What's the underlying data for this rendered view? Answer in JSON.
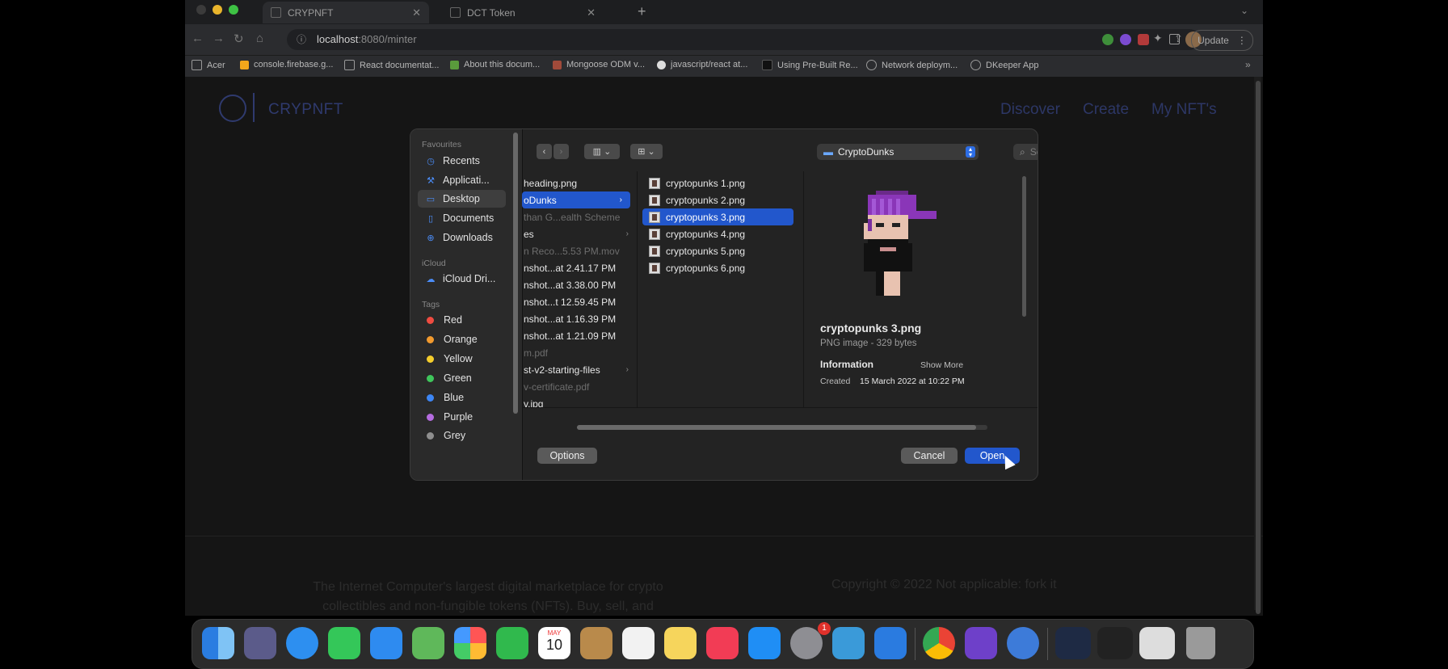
{
  "browser": {
    "tabs": [
      {
        "title": "CRYPNFT"
      },
      {
        "title": "DCT Token"
      }
    ],
    "url_host": "localhost",
    "url_path": ":8080/minter",
    "update_label": "Update",
    "bookmarks": [
      "Acer",
      "console.firebase.g...",
      "React documentat...",
      "About this docum...",
      "Mongoose ODM v...",
      "javascript/react at...",
      "Using Pre-Built Re...",
      "Network deploym...",
      "DKeeper App"
    ]
  },
  "page": {
    "logo": "CRYPNFT",
    "nav": [
      "Discover",
      "Create",
      "My NFT's"
    ],
    "footer_text": "The Internet Computer's largest digital marketplace for crypto collectibles and non-fungible tokens (NFTs). Buy, sell, and",
    "copyright": "Copyright © 2022 Not applicable: fork it"
  },
  "dialog": {
    "sidebar": {
      "favourites_heading": "Favourites",
      "favourites": [
        {
          "label": "Recents",
          "icon": "clock-icon"
        },
        {
          "label": "Applicati...",
          "icon": "applications-icon"
        },
        {
          "label": "Desktop",
          "icon": "desktop-icon",
          "selected": true
        },
        {
          "label": "Documents",
          "icon": "document-icon"
        },
        {
          "label": "Downloads",
          "icon": "downloads-icon"
        }
      ],
      "icloud_heading": "iCloud",
      "icloud": [
        {
          "label": "iCloud Dri...",
          "icon": "cloud-icon"
        }
      ],
      "tags_heading": "Tags",
      "tags": [
        {
          "label": "Red",
          "color": "#ef4c41"
        },
        {
          "label": "Orange",
          "color": "#f29a2e"
        },
        {
          "label": "Yellow",
          "color": "#f5cd2c"
        },
        {
          "label": "Green",
          "color": "#3fc65b"
        },
        {
          "label": "Blue",
          "color": "#3d86f5"
        },
        {
          "label": "Purple",
          "color": "#b56ce0"
        },
        {
          "label": "Grey",
          "color": "#8e8e8e"
        }
      ]
    },
    "location": "CryptoDunks",
    "search_placeholder": "Search",
    "column1": [
      {
        "label": "heading.png",
        "dim": false
      },
      {
        "label": "oDunks",
        "dim": false,
        "selected": true,
        "folder": true
      },
      {
        "label": "than G...ealth Scheme",
        "dim": true
      },
      {
        "label": "es",
        "dim": false,
        "folder": true
      },
      {
        "label": "n Reco...5.53 PM.mov",
        "dim": true
      },
      {
        "label": "nshot...at 2.41.17 PM",
        "dim": false
      },
      {
        "label": "nshot...at 3.38.00 PM",
        "dim": false
      },
      {
        "label": "nshot...t 12.59.45 PM",
        "dim": false
      },
      {
        "label": "nshot...at 1.16.39 PM",
        "dim": false
      },
      {
        "label": "nshot...at 1.21.09 PM",
        "dim": false
      },
      {
        "label": "m.pdf",
        "dim": true
      },
      {
        "label": "st-v2-starting-files",
        "dim": false,
        "folder": true
      },
      {
        "label": "v-certificate.pdf",
        "dim": true
      },
      {
        "label": "v.jpg",
        "dim": false
      }
    ],
    "column2": [
      {
        "label": "cryptopunks 1.png"
      },
      {
        "label": "cryptopunks 2.png"
      },
      {
        "label": "cryptopunks 3.png",
        "selected": true
      },
      {
        "label": "cryptopunks 4.png"
      },
      {
        "label": "cryptopunks 5.png"
      },
      {
        "label": "cryptopunks 6.png"
      }
    ],
    "preview": {
      "name": "cryptopunks 3.png",
      "kind": "PNG image - 329 bytes",
      "info_heading": "Information",
      "show_more": "Show More",
      "created_label": "Created",
      "created_value": "15 March 2022 at 10:22 PM"
    },
    "options_label": "Options",
    "cancel_label": "Cancel",
    "open_label": "Open"
  },
  "dock": {
    "calendar_month": "MAY",
    "calendar_day": "10",
    "badge": "1"
  },
  "colors": {
    "accent": "#2257cc",
    "page_nav": "#2d3766"
  }
}
